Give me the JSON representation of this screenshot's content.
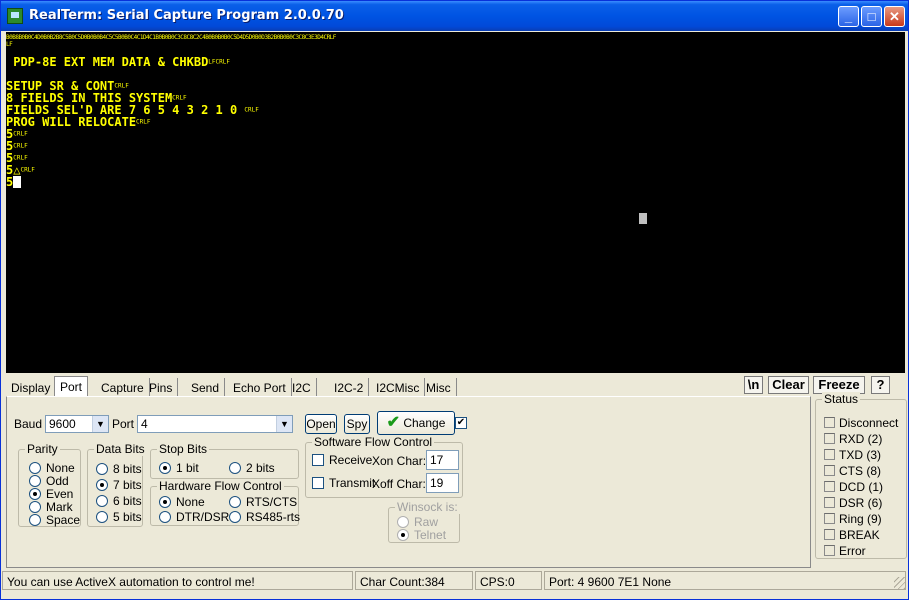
{
  "window": {
    "title": "RealTerm: Serial Capture Program 2.0.0.70",
    "controls": {
      "minimize": "_",
      "maximize": "□",
      "close": "✕"
    }
  },
  "terminal": {
    "hex_line": "B0B8B0B0C4D0B0B2B8C5B0C5D0B0B0B4C5C5B0B0C4C1D4C1B0B0B0C3C8C8C2C4B0B0B0B0C5D4D5D0B0D3B2B0B0B0C3C8C3E3D4CRLF",
    "hex_line2": "LF",
    "lines": [
      {
        "text": " PDP-8E EXT MEM DATA & CHKBD",
        "ctl": "LFCRLF"
      },
      {
        "text": "",
        "ctl": ""
      },
      {
        "text": "SETUP SR & CONT",
        "ctl": "CRLF"
      },
      {
        "text": "8 FIELDS IN THIS SYSTEM",
        "ctl": "CRLF"
      },
      {
        "text": "FIELDS SEL'D ARE 7 6 5 4 3 2 1 0 ",
        "ctl": "CRLF"
      },
      {
        "text": "PROG WILL RELOCATE",
        "ctl": "CRLF"
      },
      {
        "text": "5",
        "ctl": "CRLF"
      },
      {
        "text": "5",
        "ctl": "CRLF"
      },
      {
        "text": "5",
        "ctl": "CRLF"
      },
      {
        "text": "5△",
        "ctl": "CRLF"
      },
      {
        "text": "5",
        "ctl": ""
      }
    ]
  },
  "tabs": [
    "Display",
    "Port",
    "Capture",
    "Pins",
    "Send",
    "Echo Port",
    "I2C",
    "I2C-2",
    "I2CMisc",
    "Misc"
  ],
  "active_tab": "Port",
  "toolbar": {
    "newline_label": "\\n",
    "clear_label": "Clear",
    "freeze_label": "Freeze",
    "help_label": "?"
  },
  "port": {
    "baud_label": "Baud",
    "baud_value": "9600",
    "port_label": "Port",
    "port_value": "4",
    "open_label": "Open",
    "spy_label": "Spy",
    "change_label": "Change",
    "parity": {
      "title": "Parity",
      "options": [
        "None",
        "Odd",
        "Even",
        "Mark",
        "Space"
      ],
      "selected": "Even"
    },
    "data_bits": {
      "title": "Data Bits",
      "options": [
        "8 bits",
        "7 bits",
        "6 bits",
        "5 bits"
      ],
      "selected": "7 bits"
    },
    "stop_bits": {
      "title": "Stop Bits",
      "options": [
        "1 bit",
        "2 bits"
      ],
      "selected": "1 bit"
    },
    "hw_flow": {
      "title": "Hardware Flow Control",
      "options": [
        "None",
        "RTS/CTS",
        "DTR/DSR",
        "RS485-rts"
      ],
      "selected": "None"
    },
    "sw_flow": {
      "title": "Software Flow Control",
      "receive_label": "Receive",
      "transmit_label": "Transmit",
      "xon_label": "Xon Char:",
      "xon_value": "17",
      "xoff_label": "Xoff Char:",
      "xoff_value": "19"
    },
    "winsock": {
      "title": "Winsock is:",
      "options": [
        "Raw",
        "Telnet"
      ],
      "selected": "Telnet"
    }
  },
  "status": {
    "title": "Status",
    "items": [
      "Disconnect",
      "RXD (2)",
      "TXD (3)",
      "CTS (8)",
      "DCD (1)",
      "DSR (6)",
      "Ring (9)",
      "BREAK",
      "Error"
    ]
  },
  "statusbar": {
    "message": "You can use ActiveX automation to control me!",
    "char_count": "Char Count:384",
    "cps": "CPS:0",
    "port_info": "Port: 4 9600 7E1 None"
  },
  "colors": {
    "terminal_bg": "#000000",
    "terminal_text": "#ffff00",
    "title_bar": "#0054e3"
  }
}
